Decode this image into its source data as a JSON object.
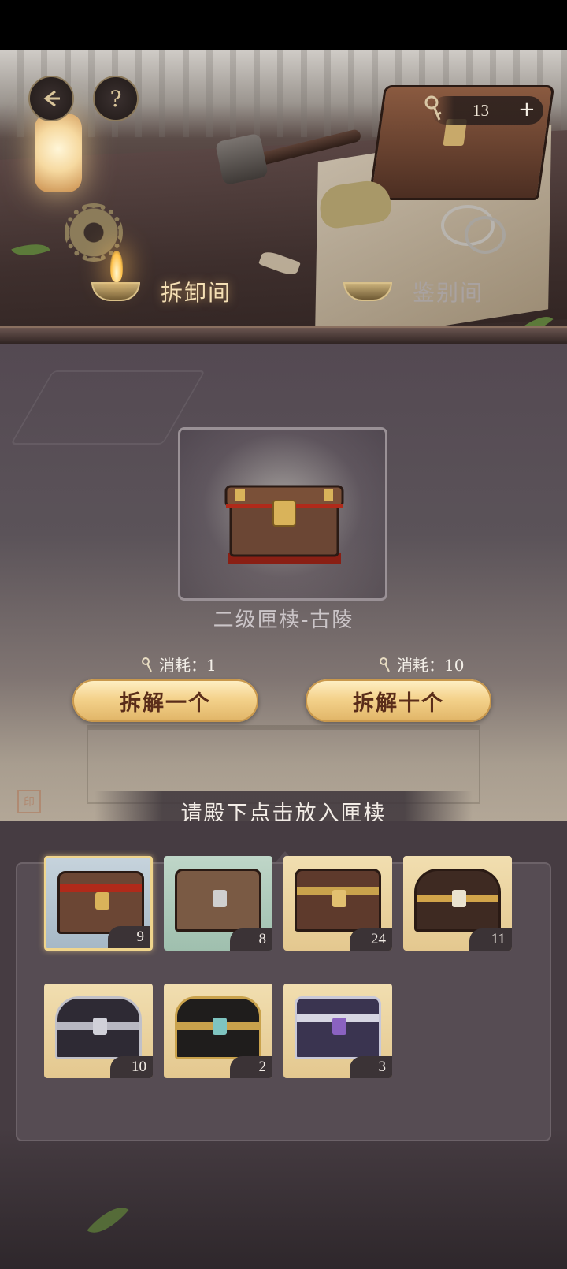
{
  "resource": {
    "count": "13",
    "plus": "+"
  },
  "tabs": {
    "dismantle": "拆卸间",
    "identify": "鉴别间"
  },
  "help_label": "?",
  "selected_chest": {
    "title": "二级匣椟-古陵"
  },
  "actions": {
    "cost_one": "消耗：1",
    "cost_ten": "消耗：10",
    "dismantle_one": "拆解一个",
    "dismantle_ten": "拆解十个"
  },
  "prompt": "请殿下点击放入匣椟",
  "inventory": [
    {
      "quantity": "9",
      "style": "red-trim-wood",
      "selected": true
    },
    {
      "quantity": "8",
      "style": "plain-wood"
    },
    {
      "quantity": "24",
      "style": "gold-ornate-wood"
    },
    {
      "quantity": "11",
      "style": "dark-gold-ornate"
    },
    {
      "quantity": "10",
      "style": "silver-black"
    },
    {
      "quantity": "2",
      "style": "black-gold-jade"
    },
    {
      "quantity": "3",
      "style": "silver-purple"
    }
  ],
  "icons": {
    "back": "back-arrow-icon",
    "help": "question-icon",
    "resource": "key-icon"
  },
  "colors": {
    "accent_gold": "#f4d28c",
    "button_text": "#5a2d1a",
    "panel": "#564c53"
  }
}
